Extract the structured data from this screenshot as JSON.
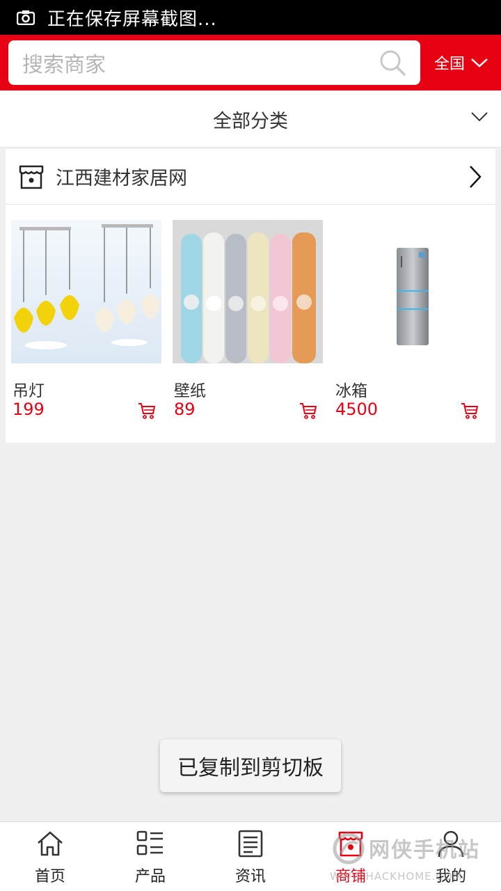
{
  "status_bar": {
    "text": "正在保存屏幕截图..."
  },
  "header": {
    "search_placeholder": "搜索商家",
    "region_label": "全国"
  },
  "category_filter": {
    "label": "全部分类"
  },
  "store": {
    "name": "江西建材家居网",
    "products": [
      {
        "name": "吊灯",
        "price": "199"
      },
      {
        "name": "壁纸",
        "price": "89"
      },
      {
        "name": "冰箱",
        "price": "4500"
      }
    ]
  },
  "toast": {
    "text": "已复制到剪切板"
  },
  "tabbar": {
    "tabs": [
      {
        "label": "首页",
        "icon": "home-icon"
      },
      {
        "label": "产品",
        "icon": "grid-list-icon"
      },
      {
        "label": "资讯",
        "icon": "news-icon"
      },
      {
        "label": "商铺",
        "icon": "shop-icon",
        "active": true
      },
      {
        "label": "我的",
        "icon": "user-icon"
      }
    ]
  },
  "watermark": {
    "title": "网侠手机站",
    "url": "WWW.HACKHOME.COM"
  },
  "colors": {
    "accent": "#e60012",
    "background": "#f0f0f0"
  }
}
